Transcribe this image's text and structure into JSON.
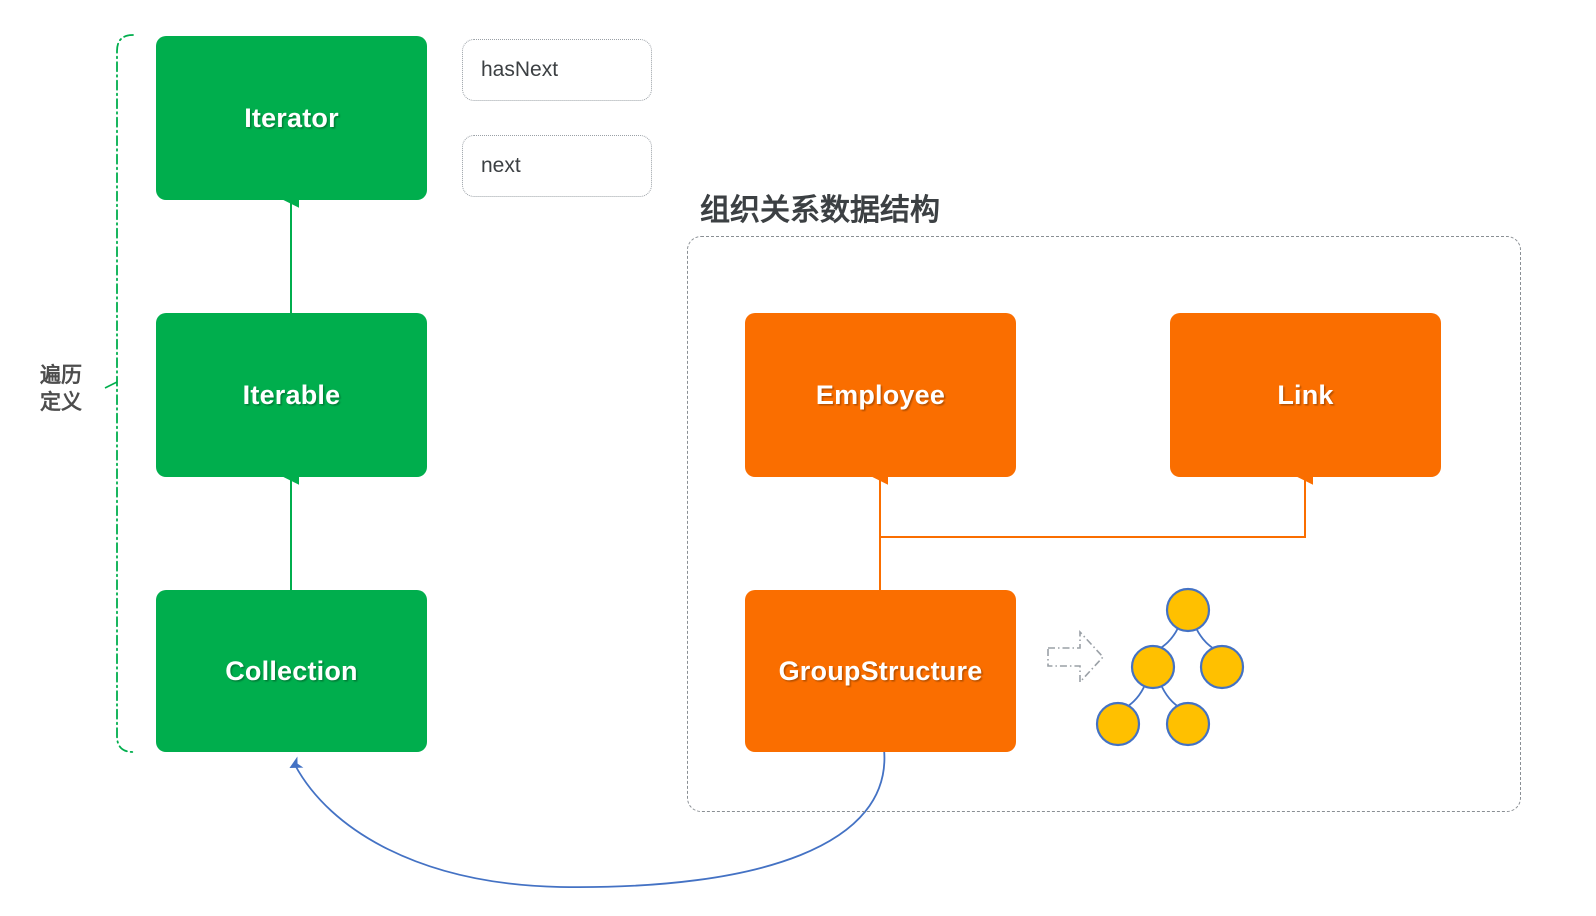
{
  "colors": {
    "green": "#00AE4D",
    "orange": "#FA6E00",
    "node_fill": "#FFC000",
    "node_stroke": "#4472C4",
    "blue_arrow": "#4472C4",
    "frame_gray": "#8a8f94",
    "text_dark": "#3c4043",
    "background": "#ffffff"
  },
  "traversal_group": {
    "bracket_label": "遍历\n定义",
    "boxes": [
      {
        "label": "Iterator"
      },
      {
        "label": "Iterable"
      },
      {
        "label": "Collection"
      }
    ],
    "methods": [
      {
        "label": "hasNext"
      },
      {
        "label": "next"
      }
    ]
  },
  "org_group": {
    "title": "组织关系数据结构",
    "boxes": [
      {
        "label": "Employee"
      },
      {
        "label": "Link"
      },
      {
        "label": "GroupStructure"
      }
    ],
    "tree": {
      "node_count": 5
    }
  }
}
